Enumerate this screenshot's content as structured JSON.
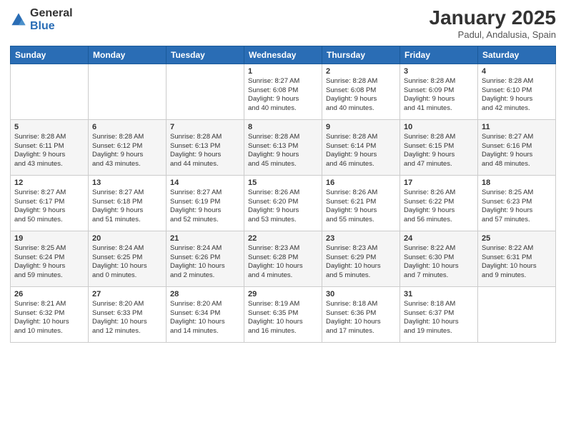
{
  "header": {
    "logo_general": "General",
    "logo_blue": "Blue",
    "month_title": "January 2025",
    "location": "Padul, Andalusia, Spain"
  },
  "weekdays": [
    "Sunday",
    "Monday",
    "Tuesday",
    "Wednesday",
    "Thursday",
    "Friday",
    "Saturday"
  ],
  "weeks": [
    [
      {
        "day": "",
        "info": ""
      },
      {
        "day": "",
        "info": ""
      },
      {
        "day": "",
        "info": ""
      },
      {
        "day": "1",
        "info": "Sunrise: 8:27 AM\nSunset: 6:08 PM\nDaylight: 9 hours\nand 40 minutes."
      },
      {
        "day": "2",
        "info": "Sunrise: 8:28 AM\nSunset: 6:08 PM\nDaylight: 9 hours\nand 40 minutes."
      },
      {
        "day": "3",
        "info": "Sunrise: 8:28 AM\nSunset: 6:09 PM\nDaylight: 9 hours\nand 41 minutes."
      },
      {
        "day": "4",
        "info": "Sunrise: 8:28 AM\nSunset: 6:10 PM\nDaylight: 9 hours\nand 42 minutes."
      }
    ],
    [
      {
        "day": "5",
        "info": "Sunrise: 8:28 AM\nSunset: 6:11 PM\nDaylight: 9 hours\nand 43 minutes."
      },
      {
        "day": "6",
        "info": "Sunrise: 8:28 AM\nSunset: 6:12 PM\nDaylight: 9 hours\nand 43 minutes."
      },
      {
        "day": "7",
        "info": "Sunrise: 8:28 AM\nSunset: 6:13 PM\nDaylight: 9 hours\nand 44 minutes."
      },
      {
        "day": "8",
        "info": "Sunrise: 8:28 AM\nSunset: 6:13 PM\nDaylight: 9 hours\nand 45 minutes."
      },
      {
        "day": "9",
        "info": "Sunrise: 8:28 AM\nSunset: 6:14 PM\nDaylight: 9 hours\nand 46 minutes."
      },
      {
        "day": "10",
        "info": "Sunrise: 8:28 AM\nSunset: 6:15 PM\nDaylight: 9 hours\nand 47 minutes."
      },
      {
        "day": "11",
        "info": "Sunrise: 8:27 AM\nSunset: 6:16 PM\nDaylight: 9 hours\nand 48 minutes."
      }
    ],
    [
      {
        "day": "12",
        "info": "Sunrise: 8:27 AM\nSunset: 6:17 PM\nDaylight: 9 hours\nand 50 minutes."
      },
      {
        "day": "13",
        "info": "Sunrise: 8:27 AM\nSunset: 6:18 PM\nDaylight: 9 hours\nand 51 minutes."
      },
      {
        "day": "14",
        "info": "Sunrise: 8:27 AM\nSunset: 6:19 PM\nDaylight: 9 hours\nand 52 minutes."
      },
      {
        "day": "15",
        "info": "Sunrise: 8:26 AM\nSunset: 6:20 PM\nDaylight: 9 hours\nand 53 minutes."
      },
      {
        "day": "16",
        "info": "Sunrise: 8:26 AM\nSunset: 6:21 PM\nDaylight: 9 hours\nand 55 minutes."
      },
      {
        "day": "17",
        "info": "Sunrise: 8:26 AM\nSunset: 6:22 PM\nDaylight: 9 hours\nand 56 minutes."
      },
      {
        "day": "18",
        "info": "Sunrise: 8:25 AM\nSunset: 6:23 PM\nDaylight: 9 hours\nand 57 minutes."
      }
    ],
    [
      {
        "day": "19",
        "info": "Sunrise: 8:25 AM\nSunset: 6:24 PM\nDaylight: 9 hours\nand 59 minutes."
      },
      {
        "day": "20",
        "info": "Sunrise: 8:24 AM\nSunset: 6:25 PM\nDaylight: 10 hours\nand 0 minutes."
      },
      {
        "day": "21",
        "info": "Sunrise: 8:24 AM\nSunset: 6:26 PM\nDaylight: 10 hours\nand 2 minutes."
      },
      {
        "day": "22",
        "info": "Sunrise: 8:23 AM\nSunset: 6:28 PM\nDaylight: 10 hours\nand 4 minutes."
      },
      {
        "day": "23",
        "info": "Sunrise: 8:23 AM\nSunset: 6:29 PM\nDaylight: 10 hours\nand 5 minutes."
      },
      {
        "day": "24",
        "info": "Sunrise: 8:22 AM\nSunset: 6:30 PM\nDaylight: 10 hours\nand 7 minutes."
      },
      {
        "day": "25",
        "info": "Sunrise: 8:22 AM\nSunset: 6:31 PM\nDaylight: 10 hours\nand 9 minutes."
      }
    ],
    [
      {
        "day": "26",
        "info": "Sunrise: 8:21 AM\nSunset: 6:32 PM\nDaylight: 10 hours\nand 10 minutes."
      },
      {
        "day": "27",
        "info": "Sunrise: 8:20 AM\nSunset: 6:33 PM\nDaylight: 10 hours\nand 12 minutes."
      },
      {
        "day": "28",
        "info": "Sunrise: 8:20 AM\nSunset: 6:34 PM\nDaylight: 10 hours\nand 14 minutes."
      },
      {
        "day": "29",
        "info": "Sunrise: 8:19 AM\nSunset: 6:35 PM\nDaylight: 10 hours\nand 16 minutes."
      },
      {
        "day": "30",
        "info": "Sunrise: 8:18 AM\nSunset: 6:36 PM\nDaylight: 10 hours\nand 17 minutes."
      },
      {
        "day": "31",
        "info": "Sunrise: 8:18 AM\nSunset: 6:37 PM\nDaylight: 10 hours\nand 19 minutes."
      },
      {
        "day": "",
        "info": ""
      }
    ]
  ]
}
